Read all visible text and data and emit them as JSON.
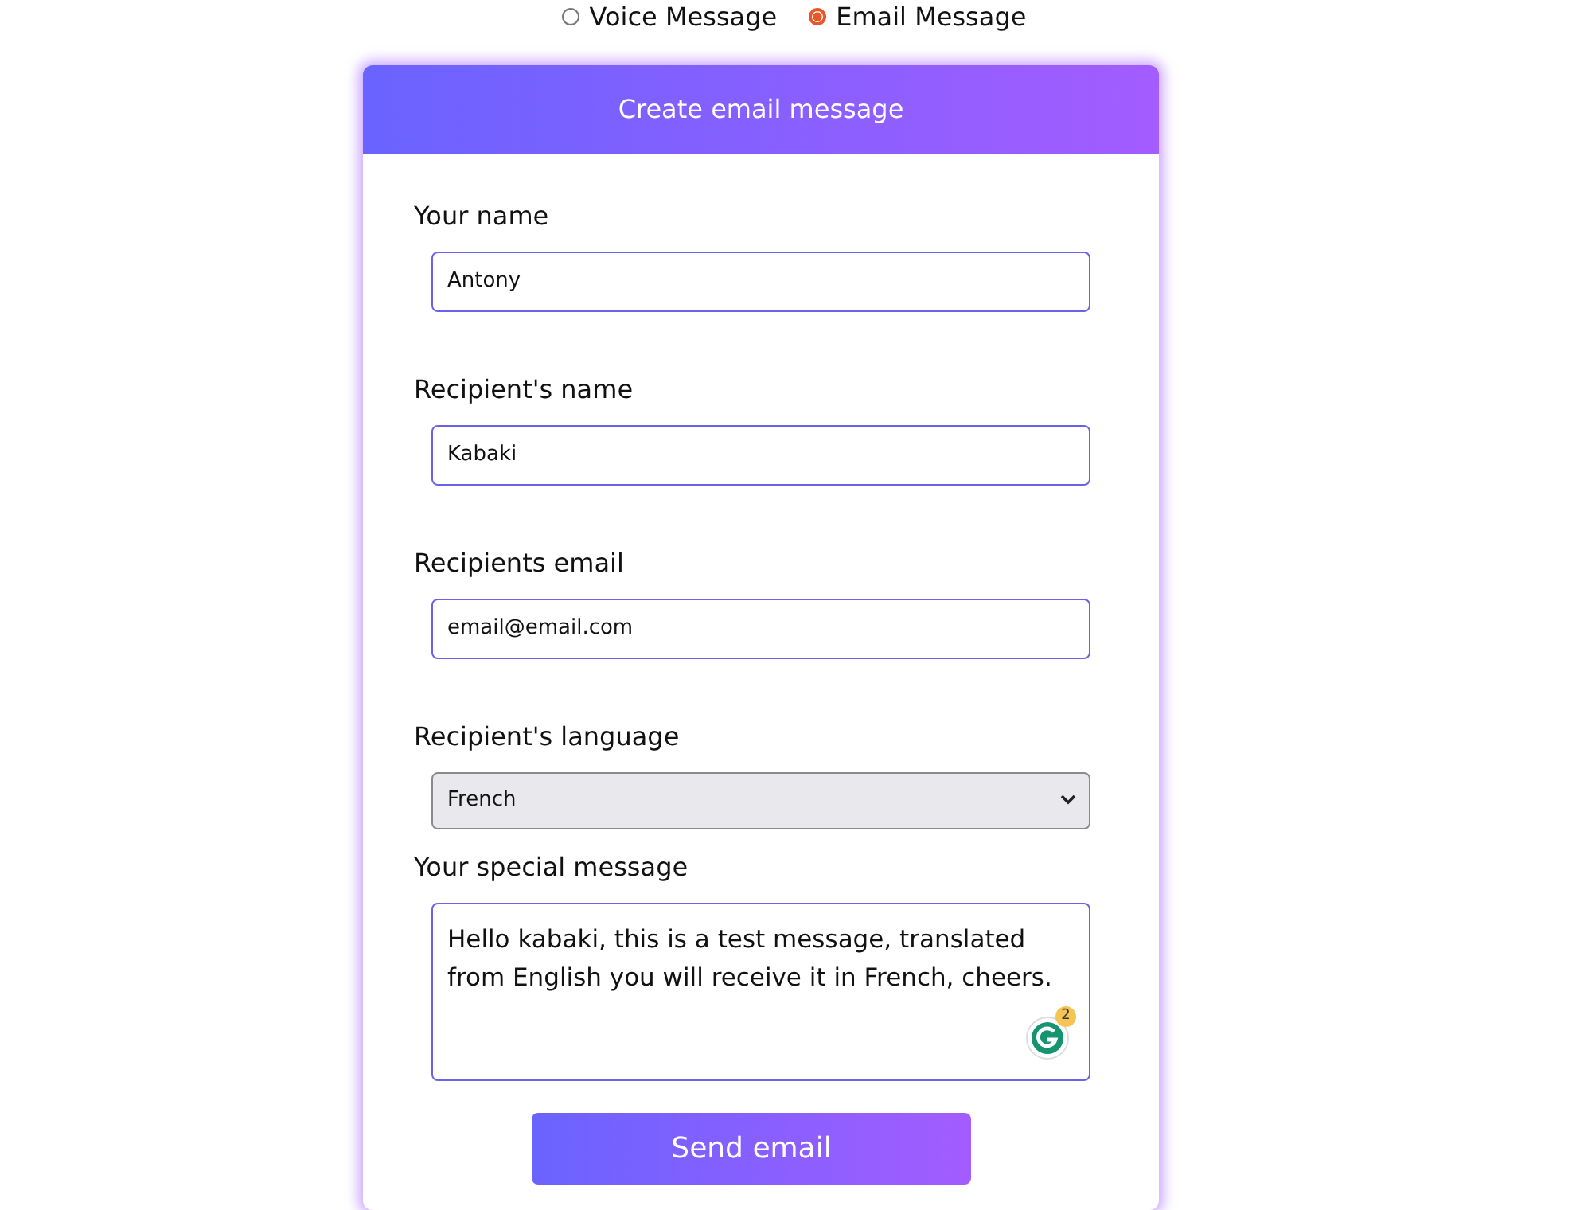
{
  "mode_options": [
    {
      "label": "Voice Message",
      "selected": false
    },
    {
      "label": "Email Message",
      "selected": true
    }
  ],
  "card": {
    "title": "Create email message",
    "fields": [
      {
        "kind": "text",
        "label": "Your name",
        "value": "Antony"
      },
      {
        "kind": "text",
        "label": "Recipient's name",
        "value": "Kabaki"
      },
      {
        "kind": "text",
        "label": "Recipients email",
        "value": "email@email.com"
      },
      {
        "kind": "select",
        "label": "Recipient's language",
        "value": "French"
      },
      {
        "kind": "textarea",
        "label": "Your special message",
        "value": "Hello kabaki, this is a test message, translated from English you will receive it in French, cheers.",
        "assistant_badge": "2"
      }
    ],
    "submit": "Send email"
  }
}
